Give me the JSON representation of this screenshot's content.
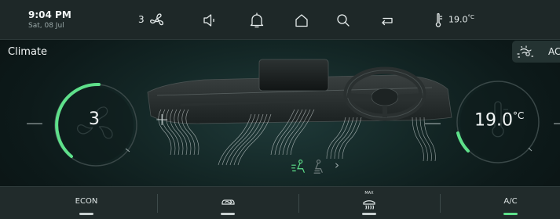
{
  "status_bar": {
    "time": "9:04 PM",
    "date": "Sat, 08 Jul",
    "fan_level": "3",
    "temperature": "19.0",
    "temperature_unit": "°C",
    "icons": [
      "fan-icon",
      "volume-icon",
      "bell-icon",
      "home-icon",
      "search-icon",
      "return-icon",
      "thermometer-icon"
    ]
  },
  "page": {
    "title": "Climate",
    "ac_chip_label": "AC"
  },
  "fan_dial": {
    "value": "3",
    "minus": "—",
    "plus": "+",
    "level_fraction": 0.33
  },
  "temp_dial": {
    "value": "19.0",
    "unit": "°C",
    "minus": "—",
    "plus": "—",
    "level_fraction": 0.12
  },
  "airflow": {
    "chevron": "›",
    "icons": [
      "airflow-face-icon",
      "airflow-feet-icon"
    ]
  },
  "bottom_bar": {
    "items": [
      {
        "label": "ECON",
        "icon": "",
        "active": false
      },
      {
        "label": "",
        "icon": "recirculation-icon",
        "active": false
      },
      {
        "label": "",
        "icon": "max-defrost-icon",
        "active": false
      },
      {
        "label": "A/C",
        "icon": "",
        "active": true
      }
    ],
    "max_label": "MAX"
  },
  "colors": {
    "accent": "#5ee08a",
    "background": "#0b1414",
    "bar": "#212b2b"
  }
}
